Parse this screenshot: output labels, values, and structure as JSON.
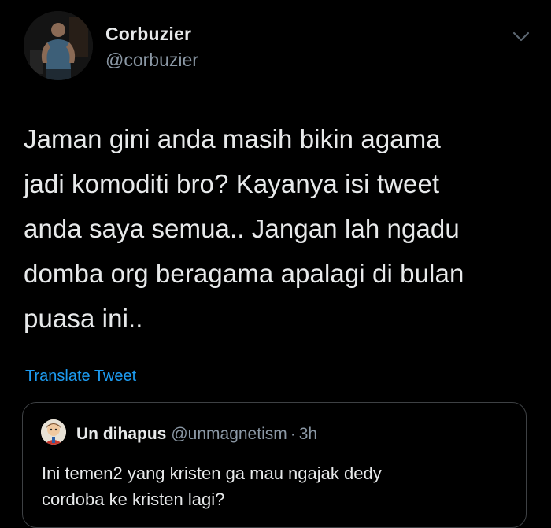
{
  "tweet": {
    "author": {
      "display_name": "Corbuzier",
      "handle": "@corbuzier",
      "avatar_icon": "profile-photo-avatar"
    },
    "more_icon": "chevron-down-icon",
    "text": "Jaman gini anda masih bikin agama\njadi komoditi bro? Kayanya isi tweet\nanda saya semua.. Jangan lah ngadu\ndomba org beragama apalagi di bulan\npuasa ini..",
    "translate_label": "Translate Tweet"
  },
  "quote": {
    "display_name": "Un dihapus",
    "handle": "@unmagnetism",
    "separator": "·",
    "time": "3h",
    "text": "Ini temen2 yang kristen ga mau ngajak dedy\ncordoba ke kristen lagi?",
    "avatar_icon": "cartoon-avatar"
  },
  "colors": {
    "background": "#000000",
    "primary_text": "#e7e9ea",
    "secondary_text": "#8b98a5",
    "link": "#1d9bf0",
    "border": "#3e4144"
  }
}
